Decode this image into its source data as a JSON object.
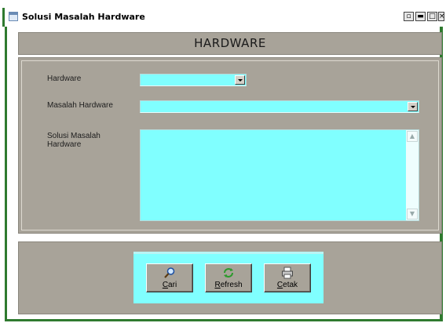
{
  "window": {
    "title": "Solusi Masalah Hardware",
    "controls": {
      "restore_glyph": "▫",
      "minimize_glyph": "▬",
      "maximize_glyph": "□",
      "close_glyph": "×"
    }
  },
  "header": {
    "title": "HARDWARE"
  },
  "form": {
    "hardware": {
      "label": "Hardware",
      "value": ""
    },
    "masalah": {
      "label": "Masalah Hardware",
      "value": ""
    },
    "solusi": {
      "label_line1": "Solusi Masalah",
      "label_line2": "Hardware",
      "value": ""
    }
  },
  "actions": {
    "cari": {
      "hotkey": "C",
      "rest": "ari",
      "icon": "search-icon"
    },
    "refresh": {
      "hotkey": "R",
      "rest": "efresh",
      "icon": "refresh-icon"
    },
    "cetak": {
      "hotkey": "C",
      "rest": "etak",
      "icon": "print-icon"
    }
  },
  "colors": {
    "field_bg": "#80ffff",
    "panel_bg": "#a8a399",
    "frame": "#2f7a2f"
  }
}
